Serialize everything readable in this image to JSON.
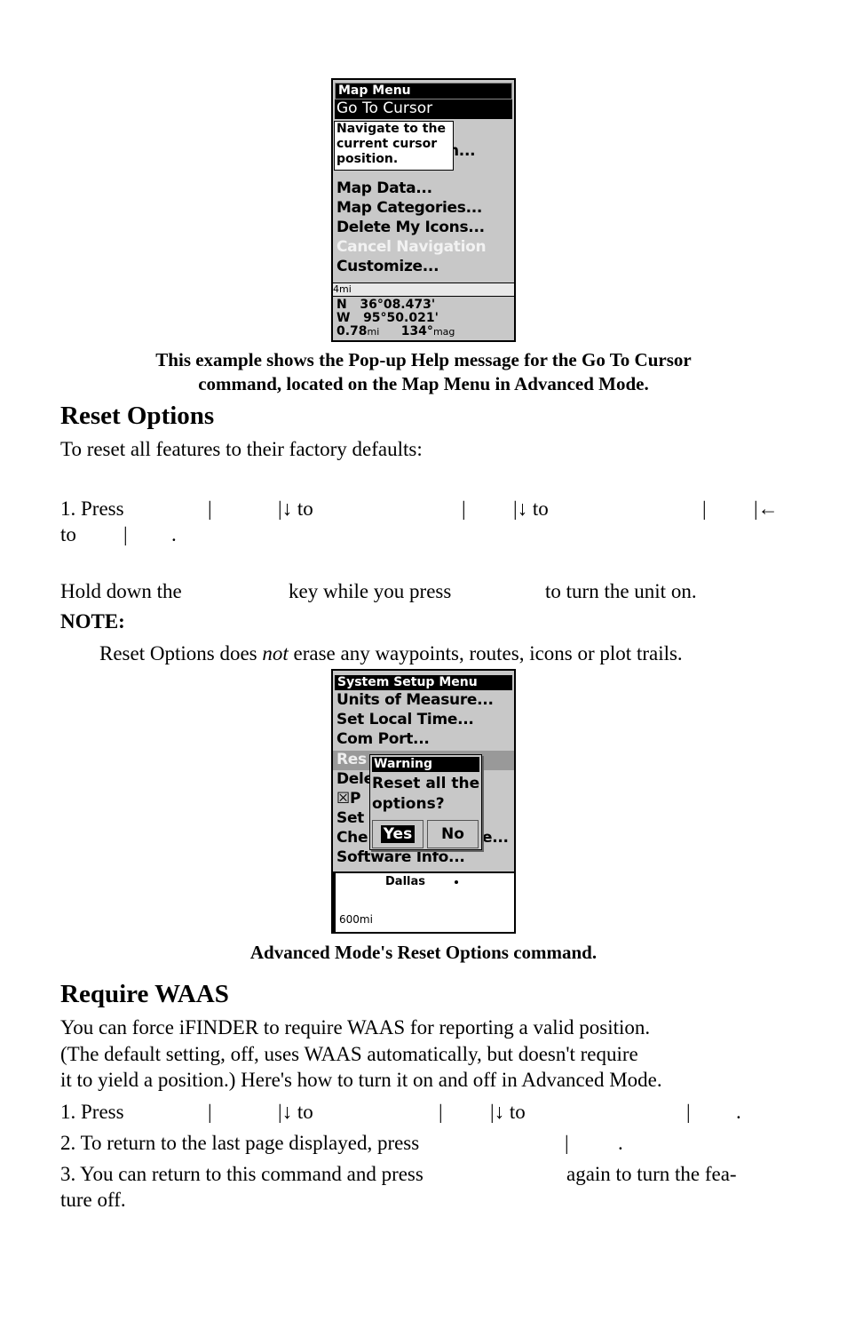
{
  "screen1": {
    "title": "Map Menu",
    "selected": "Go To Cursor",
    "popup": [
      "Navigate to the",
      "current cursor",
      "position."
    ],
    "partial_item": "n...",
    "items": [
      "Map Data...",
      "Map Categories...",
      "Delete My Icons...",
      "Cancel Navigation",
      "Customize..."
    ],
    "scale": "4mi",
    "lat": "N   36°08.473'",
    "lon": "W   95°50.021'",
    "dist": "0.78",
    "dist_unit": "mi",
    "bearing": "134°",
    "bearing_unit": "mag"
  },
  "caption1": [
    "This example shows the Pop-up Help message for the Go To Cursor",
    "command, located on the Map Menu in Advanced Mode."
  ],
  "reset": {
    "heading": "Reset Options",
    "intro": "To reset all features to their factory defaults:",
    "step1": [
      "1. Press",
      "|",
      "|↓ to",
      "|",
      "|↓ to",
      "|",
      "|←"
    ],
    "step1b": [
      "to",
      "|",
      "."
    ],
    "hold": [
      "Hold down the",
      "key while you press",
      "to turn the unit on."
    ],
    "note_label": "NOTE:",
    "note": [
      "Reset Options does ",
      "not",
      " erase any waypoints, routes, icons or plot trails."
    ]
  },
  "screen2": {
    "title": "System Setup Menu",
    "items": [
      "Units of Measure...",
      "Set Local Time...",
      "Com Port..."
    ],
    "partials": [
      "Res",
      "Dele",
      "P",
      "Set",
      "Che",
      "e..."
    ],
    "last": "Software Info...",
    "dialog_title": "Warning",
    "dialog_text": [
      "Reset all the",
      "options?"
    ],
    "yes": "Yes",
    "no": "No",
    "map_label": "Dallas",
    "map_scale": "600mi"
  },
  "caption2": "Advanced Mode's Reset Options command.",
  "waas": {
    "heading": "Require WAAS",
    "para": [
      "You can force iFINDER to require WAAS for reporting a valid position.",
      "(The default setting, off, uses WAAS automatically, but doesn't require",
      "it to yield a position.) Here's how to turn it on and off in Advanced Mode."
    ],
    "step1": [
      "1. Press",
      "|",
      "|↓ to",
      "|",
      "|↓ to",
      "|",
      "."
    ],
    "step2": [
      "2. To return to the last page displayed, press",
      "|",
      "."
    ],
    "step3": [
      "3. You can return to this command and press",
      "again to turn the fea-"
    ],
    "step3b": "ture off."
  }
}
